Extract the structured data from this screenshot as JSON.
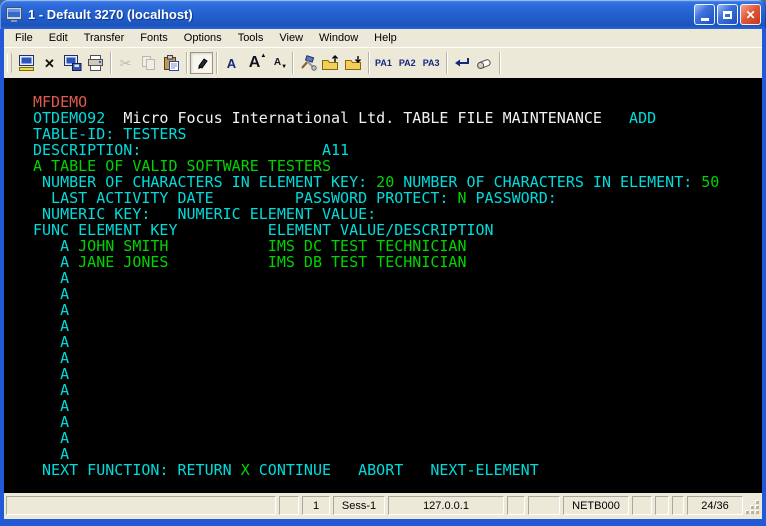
{
  "window": {
    "title": "1 - Default 3270 (localhost)",
    "buttons": {
      "minimize": "minimize",
      "maximize": "maximize",
      "close": "close"
    }
  },
  "menu": {
    "items": [
      "File",
      "Edit",
      "Transfer",
      "Fonts",
      "Options",
      "Tools",
      "View",
      "Window",
      "Help"
    ]
  },
  "toolbar": {
    "pa_buttons": [
      "PA1",
      "PA2",
      "PA3"
    ],
    "icons": [
      "connect-icon",
      "disconnect-icon",
      "save-screen-icon",
      "print-icon",
      "cut-icon",
      "copy-icon",
      "paste-icon",
      "light-pen-icon",
      "font-select-icon",
      "font-larger-icon",
      "font-smaller-icon",
      "settings-icon",
      "send-file-icon",
      "receive-file-icon",
      "enter-icon",
      "erase-icon"
    ],
    "font_letter": "A",
    "disconnect_glyph": "✕",
    "cut_glyph": "✂",
    "caret_up": "▲",
    "caret_down": "▼"
  },
  "terminal": {
    "colors": {
      "red": "#e05b4b",
      "cyan": "#00dcdc",
      "green": "#00d400",
      "white": "#f2f2f2",
      "background": "#000000"
    },
    "lines": [
      [
        [
          "r",
          "MFDEMO"
        ]
      ],
      [
        [
          "c",
          "OTDEMO92"
        ],
        [
          "s",
          "  "
        ],
        [
          "w",
          "Micro Focus International Ltd. TABLE FILE MAINTENANCE"
        ],
        [
          "s",
          "   "
        ],
        [
          "c",
          "ADD"
        ]
      ],
      [
        [
          "c",
          "TABLE-ID: TESTERS"
        ]
      ],
      [
        [
          "c",
          "DESCRIPTION:"
        ],
        [
          "s",
          "                    "
        ],
        [
          "c",
          "A11"
        ]
      ],
      [
        [
          "g",
          "A TABLE OF VALID SOFTWARE TESTERS"
        ]
      ],
      [
        [
          "c",
          " NUMBER OF CHARACTERS IN ELEMENT KEY: "
        ],
        [
          "g",
          "20"
        ],
        [
          "s",
          " "
        ],
        [
          "c",
          "NUMBER OF CHARACTERS IN ELEMENT: "
        ],
        [
          "g",
          "50"
        ]
      ],
      [
        [
          "c",
          "  LAST ACTIVITY DATE"
        ],
        [
          "s",
          "         "
        ],
        [
          "c",
          "PASSWORD PROTECT: "
        ],
        [
          "g",
          "N"
        ],
        [
          "s",
          " "
        ],
        [
          "c",
          "PASSWORD:"
        ]
      ],
      [
        [
          "c",
          " NUMERIC KEY:   NUMERIC ELEMENT VALUE:"
        ]
      ],
      [
        [
          "c",
          "FUNC ELEMENT KEY          ELEMENT VALUE/DESCRIPTION"
        ]
      ],
      [
        [
          "s",
          "   "
        ],
        [
          "c",
          "A"
        ],
        [
          "s",
          " "
        ],
        [
          "g",
          "JOHN SMITH"
        ],
        [
          "s",
          "           "
        ],
        [
          "g",
          "IMS DC TEST TECHNICIAN"
        ]
      ],
      [
        [
          "s",
          "   "
        ],
        [
          "c",
          "A"
        ],
        [
          "s",
          " "
        ],
        [
          "g",
          "JANE JONES"
        ],
        [
          "s",
          "           "
        ],
        [
          "g",
          "IMS DB TEST TECHNICIAN"
        ]
      ],
      [
        [
          "s",
          "   "
        ],
        [
          "c",
          "A"
        ]
      ],
      [
        [
          "s",
          "   "
        ],
        [
          "c",
          "A"
        ]
      ],
      [
        [
          "s",
          "   "
        ],
        [
          "c",
          "A"
        ]
      ],
      [
        [
          "s",
          "   "
        ],
        [
          "c",
          "A"
        ]
      ],
      [
        [
          "s",
          "   "
        ],
        [
          "c",
          "A"
        ]
      ],
      [
        [
          "s",
          "   "
        ],
        [
          "c",
          "A"
        ]
      ],
      [
        [
          "s",
          "   "
        ],
        [
          "c",
          "A"
        ]
      ],
      [
        [
          "s",
          "   "
        ],
        [
          "c",
          "A"
        ]
      ],
      [
        [
          "s",
          "   "
        ],
        [
          "c",
          "A"
        ]
      ],
      [
        [
          "s",
          "   "
        ],
        [
          "c",
          "A"
        ]
      ],
      [
        [
          "s",
          "   "
        ],
        [
          "c",
          "A"
        ]
      ],
      [
        [
          "s",
          "   "
        ],
        [
          "c",
          "A"
        ]
      ],
      [
        [
          "c",
          " NEXT FUNCTION: RETURN "
        ],
        [
          "g",
          "X"
        ],
        [
          "s",
          " "
        ],
        [
          "c",
          "CONTINUE   ABORT   NEXT-ELEMENT"
        ]
      ]
    ]
  },
  "status": {
    "fields": [
      "",
      "",
      "1",
      "Sess-1",
      "127.0.0.1",
      "",
      "",
      "NETB000",
      "",
      "",
      "",
      "24/36"
    ]
  }
}
